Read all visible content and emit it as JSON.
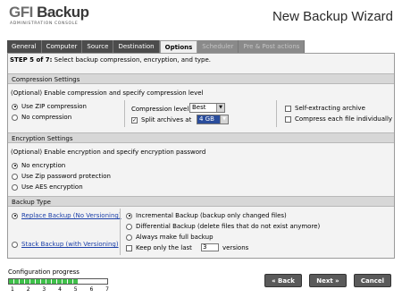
{
  "header": {
    "logo_gfi": "GFI",
    "logo_backup": "Backup",
    "logo_sub": "ADMINISTRATION CONSOLE",
    "title": "New Backup Wizard"
  },
  "tabs": [
    {
      "label": "General",
      "state": "normal"
    },
    {
      "label": "Computer",
      "state": "normal"
    },
    {
      "label": "Source",
      "state": "normal"
    },
    {
      "label": "Destination",
      "state": "normal"
    },
    {
      "label": "Options",
      "state": "active"
    },
    {
      "label": "Scheduler",
      "state": "disabled"
    },
    {
      "label": "Pre & Post actions",
      "state": "disabled"
    }
  ],
  "step": {
    "bold": "STEP 5 of 7:",
    "text": " Select backup compression, encryption, and type."
  },
  "compression": {
    "header": "Compression Settings",
    "description": "(Optional) Enable compression and specify compression level",
    "use_zip": "Use ZIP compression",
    "no_compression": "No compression",
    "level_label": "Compression level",
    "level_value": "Best",
    "split_label": "Split archives at",
    "split_value": "4 GB",
    "self_extracting": "Self-extracting archive",
    "compress_each": "Compress each file individually"
  },
  "encryption": {
    "header": "Encryption Settings",
    "description": "(Optional) Enable encryption and specify encryption password",
    "no_encryption": "No encryption",
    "zip_password": "Use Zip password protection",
    "aes": "Use AES encryption"
  },
  "backup_type": {
    "header": "Backup Type",
    "replace": "Replace Backup (No Versioning)",
    "stack": "Stack Backup (with Versioning)",
    "incremental": "Incremental Backup (backup only changed files)",
    "differential": "Differential Backup (delete files that do not exist anymore)",
    "always_full": "Always make full backup",
    "keep_last": "Keep only the last",
    "versions_value": "3",
    "versions_label": "versions"
  },
  "footer": {
    "progress_label": "Configuration progress",
    "progress_fraction": 0.71,
    "ticks": [
      "1",
      "2",
      "3",
      "4",
      "5",
      "6",
      "7"
    ],
    "back": "« Back",
    "next": "Next »",
    "cancel": "Cancel"
  }
}
